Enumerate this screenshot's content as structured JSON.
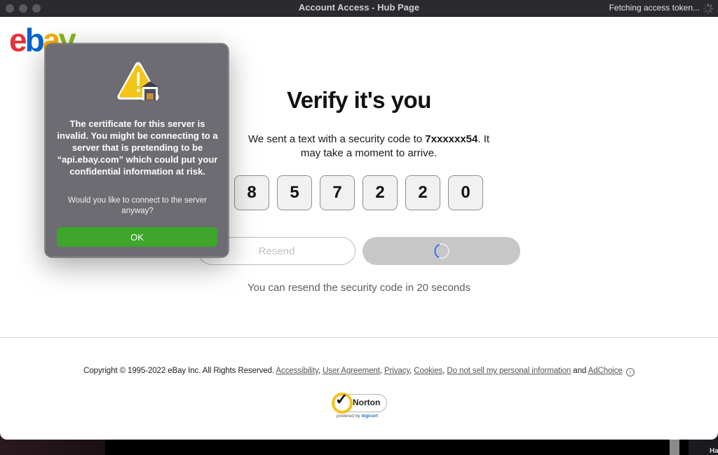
{
  "window": {
    "title": "Account Access - Hub Page",
    "status": "Fetching access token...",
    "status_icon": "spinner-icon"
  },
  "brand": {
    "logo_letters": [
      "e",
      "b",
      "a",
      "y"
    ],
    "logo_colors": [
      "#e53238",
      "#0064d2",
      "#f5af02",
      "#86b817"
    ]
  },
  "verify": {
    "heading": "Verify it's you",
    "desc_prefix": "We sent a text with a security code to ",
    "phone": "7xxxxxx54",
    "desc_suffix": ". It may take a moment to arrive.",
    "code_digits": [
      "8",
      "5",
      "7",
      "2",
      "2",
      "0"
    ],
    "resend_label": "Resend",
    "submit_state": "loading",
    "resend_info": "You can resend the security code in 20 seconds"
  },
  "footer": {
    "copyright": "Copyright © 1995-2022 eBay Inc. All Rights Reserved.",
    "links": [
      "Accessibility",
      "User Agreement",
      "Privacy",
      "Cookies",
      "Do not sell my personal information"
    ],
    "and_text": "and",
    "adchoice": "AdChoice",
    "norton_name": "Norton",
    "norton_powered": "powered by",
    "norton_partner": "digicert"
  },
  "dialog": {
    "icon": "warning-certificate-icon",
    "title": "The certificate for this server is invalid. You might be connecting to a server that is pretending to be “api.ebay.com” which could put your confidential information at risk.",
    "message": "Would you like to connect to the server anyway?",
    "ok_label": "OK"
  },
  "desktop": {
    "right_label": "Ha"
  }
}
